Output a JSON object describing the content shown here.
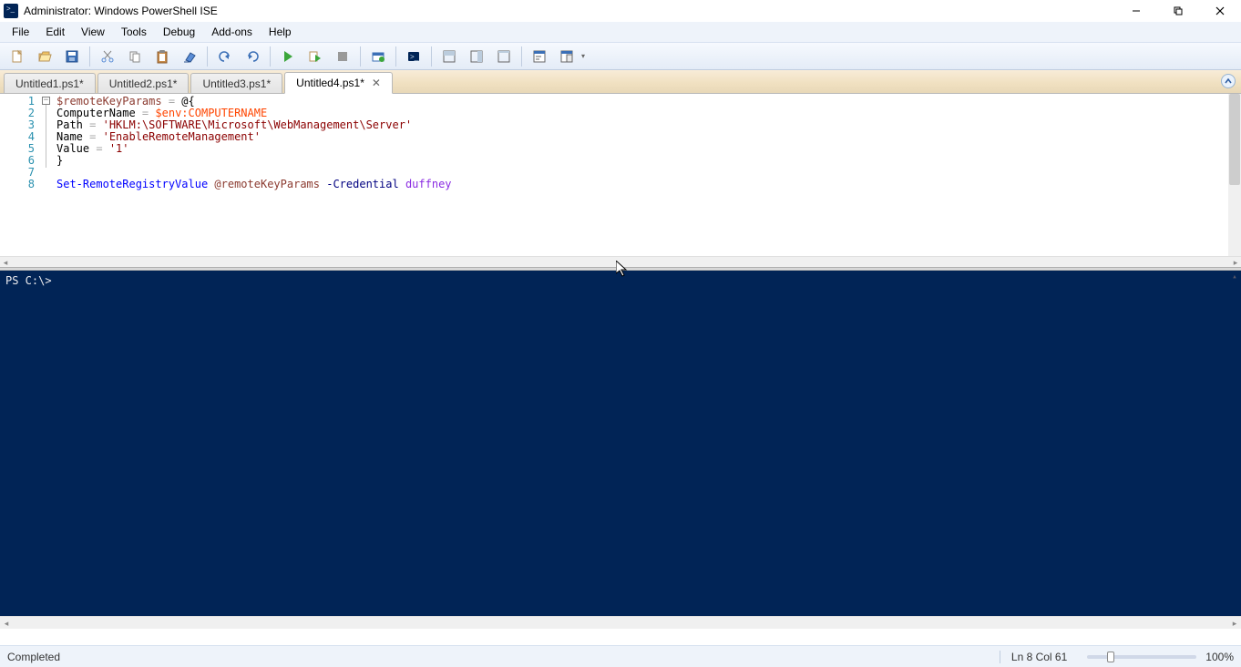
{
  "window": {
    "title": "Administrator: Windows PowerShell ISE"
  },
  "menu": {
    "file": "File",
    "edit": "Edit",
    "view": "View",
    "tools": "Tools",
    "debug": "Debug",
    "addons": "Add-ons",
    "help": "Help"
  },
  "tabs": {
    "t1": "Untitled1.ps1*",
    "t2": "Untitled2.ps1*",
    "t3": "Untitled3.ps1*",
    "t4": "Untitled4.ps1*"
  },
  "gutter": {
    "l1": "1",
    "l2": "2",
    "l3": "3",
    "l4": "4",
    "l5": "5",
    "l6": "6",
    "l7": "7",
    "l8": "8"
  },
  "code": {
    "l1_var": "$remoteKeyParams",
    "l1_op": " = ",
    "l1_rest": "@{",
    "l2_key": "ComputerName",
    "l2_op": " = ",
    "l2_env": "$env:COMPUTERNAME",
    "l3_key": "Path",
    "l3_op": " = ",
    "l3_str": "'HKLM:\\SOFTWARE\\Microsoft\\WebManagement\\Server'",
    "l4_key": "Name",
    "l4_op": " = ",
    "l4_str": "'EnableRemoteManagement'",
    "l5_key": "Value",
    "l5_op": " = ",
    "l5_str": "'1'",
    "l6": "}",
    "l7": "",
    "l8_cmd": "Set-RemoteRegistryValue",
    "l8_sp": " ",
    "l8_splat": "@remoteKeyParams",
    "l8_sp2": " ",
    "l8_param": "-Credential",
    "l8_sp3": " ",
    "l8_id": "duffney"
  },
  "console": {
    "prompt": "PS C:\\> "
  },
  "status": {
    "left": "Completed",
    "pos": "Ln 8  Col 61",
    "zoom": "100%"
  }
}
